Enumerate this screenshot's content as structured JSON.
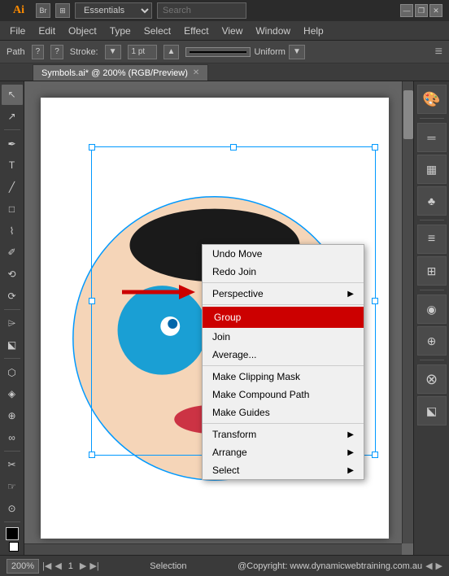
{
  "app": {
    "logo": "Ai",
    "title": "Adobe Illustrator",
    "workspace": "Essentials",
    "search_placeholder": "Search"
  },
  "window_controls": {
    "minimize": "—",
    "restore": "❐",
    "close": "✕"
  },
  "menu_bar": {
    "items": [
      "File",
      "Edit",
      "Object",
      "Type",
      "Select",
      "Effect",
      "View",
      "Window",
      "Help"
    ]
  },
  "options_bar": {
    "label": "Path",
    "stroke_label": "Stroke:",
    "stroke_value": "1 pt",
    "stroke_type": "Uniform"
  },
  "tab": {
    "label": "Symbols.ai* @ 200% (RGB/Preview)"
  },
  "context_menu": {
    "items": [
      {
        "id": "undo-move",
        "label": "Undo Move",
        "disabled": false,
        "arrow": false,
        "separator_after": false
      },
      {
        "id": "redo-join",
        "label": "Redo Join",
        "disabled": false,
        "arrow": false,
        "separator_after": false
      },
      {
        "id": "sep1",
        "separator": true
      },
      {
        "id": "perspective",
        "label": "Perspective",
        "disabled": false,
        "arrow": true,
        "separator_after": true
      },
      {
        "id": "sep2",
        "separator": true
      },
      {
        "id": "group",
        "label": "Group",
        "disabled": false,
        "arrow": false,
        "highlighted": true,
        "separator_after": false
      },
      {
        "id": "join",
        "label": "Join",
        "disabled": false,
        "arrow": false,
        "separator_after": false
      },
      {
        "id": "average",
        "label": "Average...",
        "disabled": false,
        "arrow": false,
        "separator_after": true
      },
      {
        "id": "sep3",
        "separator": true
      },
      {
        "id": "clipping-mask",
        "label": "Make Clipping Mask",
        "disabled": false,
        "arrow": false,
        "separator_after": false
      },
      {
        "id": "compound-path",
        "label": "Make Compound Path",
        "disabled": false,
        "arrow": false,
        "separator_after": false
      },
      {
        "id": "guides",
        "label": "Make Guides",
        "disabled": false,
        "arrow": false,
        "separator_after": true
      },
      {
        "id": "sep4",
        "separator": true
      },
      {
        "id": "transform",
        "label": "Transform",
        "disabled": false,
        "arrow": true,
        "separator_after": false
      },
      {
        "id": "arrange",
        "label": "Arrange",
        "disabled": false,
        "arrow": true,
        "separator_after": false
      },
      {
        "id": "select",
        "label": "Select",
        "disabled": false,
        "arrow": true,
        "separator_after": false
      }
    ]
  },
  "status_bar": {
    "zoom": "200%",
    "info": "Selection",
    "copyright": "@Copyright: www.dynamicwebtraining.com.au"
  },
  "left_tools": [
    "↖",
    "✦",
    "✐",
    "⬚",
    "⟲",
    "✂",
    "✒",
    "T",
    "⬡",
    "◯",
    "⌇",
    "⬔",
    "⟆",
    "☞",
    "⬡",
    "⬕",
    "⊕",
    "⊗"
  ],
  "right_panels": [
    "🎨",
    "≡",
    "⊞",
    "♣",
    "═",
    "⊟",
    "◉",
    "⊕",
    "⊗"
  ]
}
